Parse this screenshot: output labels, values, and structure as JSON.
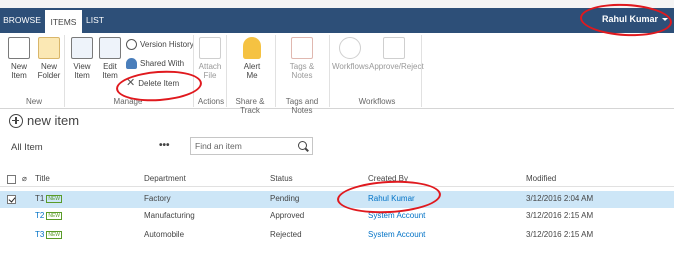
{
  "tabs": {
    "browse": "BROWSE",
    "items": "ITEMS",
    "list": "LIST"
  },
  "user": {
    "name": "Rahul Kumar"
  },
  "ribbon": {
    "new_item": "New\nItem",
    "new_folder": "New\nFolder",
    "group_new": "New",
    "view_item": "View\nItem",
    "edit_item": "Edit\nItem",
    "version_history": "Version History",
    "shared_with": "Shared With",
    "delete_item": "Delete Item",
    "group_manage": "Manage",
    "attach_file": "Attach\nFile",
    "group_actions": "Actions",
    "alert_me": "Alert\nMe",
    "group_share": "Share & Track",
    "tags_notes": "Tags &\nNotes",
    "group_tags": "Tags and Notes",
    "workflows": "Workflows",
    "approve_reject": "Approve/Reject",
    "group_workflows": "Workflows"
  },
  "list": {
    "new_item_link": "new item",
    "view_name": "All Item",
    "ellipsis": "•••",
    "search_placeholder": "Find an item"
  },
  "table": {
    "columns": [
      "Title",
      "Department",
      "Status",
      "Created By",
      "Modified"
    ],
    "new_badge": "NEW",
    "rows": [
      {
        "title": "T1",
        "department": "Factory",
        "status": "Pending",
        "created_by": "Rahul Kumar",
        "modified": "3/12/2016 2:04 AM",
        "selected": true
      },
      {
        "title": "T2",
        "department": "Manufacturing",
        "status": "Approved",
        "created_by": "System Account",
        "modified": "3/12/2016 2:15 AM",
        "selected": false
      },
      {
        "title": "T3",
        "department": "Automobile",
        "status": "Rejected",
        "created_by": "System Account",
        "modified": "3/12/2016 2:15 AM",
        "selected": false
      }
    ]
  },
  "colors": {
    "suite_bar": "#2d4f78",
    "link": "#0072c6",
    "selected_row": "#cde6f7",
    "annotation": "#e0191e"
  }
}
